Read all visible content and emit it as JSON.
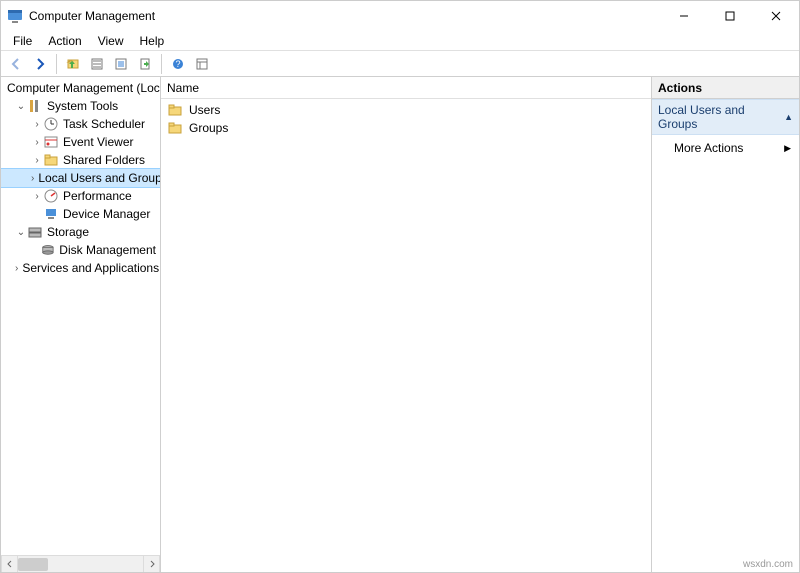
{
  "window": {
    "title": "Computer Management"
  },
  "menubar": {
    "file": "File",
    "action": "Action",
    "view": "View",
    "help": "Help"
  },
  "toolbar_icons": {
    "back": "back-icon",
    "forward": "forward-icon",
    "up": "up-icon",
    "properties": "properties-icon",
    "refresh": "refresh-icon",
    "export": "export-icon",
    "help": "help-icon",
    "details": "details-icon"
  },
  "tree": {
    "root": "Computer Management (Local",
    "system_tools": {
      "label": "System Tools",
      "task_scheduler": "Task Scheduler",
      "event_viewer": "Event Viewer",
      "shared_folders": "Shared Folders",
      "local_users_groups": "Local Users and Groups",
      "performance": "Performance",
      "device_manager": "Device Manager"
    },
    "storage": {
      "label": "Storage",
      "disk_management": "Disk Management"
    },
    "services_apps": "Services and Applications"
  },
  "list": {
    "header_name": "Name",
    "items": [
      {
        "label": "Users"
      },
      {
        "label": "Groups"
      }
    ]
  },
  "actions": {
    "title": "Actions",
    "group": "Local Users and Groups",
    "more": "More Actions"
  },
  "watermark": "wsxdn.com"
}
